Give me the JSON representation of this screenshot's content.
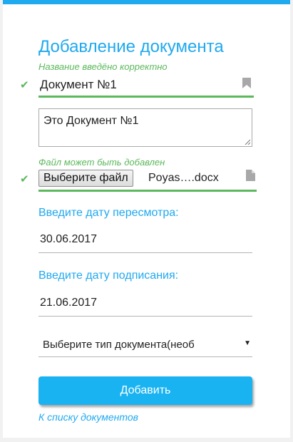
{
  "form": {
    "title": "Добавление документа",
    "name_hint": "Название введёно корректно",
    "name_value": "Документ №1",
    "description_value": "Это Документ №1",
    "file_hint": "Файл может быть добавлен",
    "file_button_label": "Выберите файл",
    "file_name": "Poyas….docx",
    "review_date_label": "Введите дату пересмотра:",
    "review_date_value": "30.06.2017",
    "sign_date_label": "Введите дату подписания:",
    "sign_date_value": "21.06.2017",
    "doc_type_selected": "Выберите тип документа(необ",
    "submit_label": "Добавить",
    "back_link": "К списку документов"
  },
  "colors": {
    "accent": "#1fa9ef",
    "valid": "#5cb85c",
    "button": "#19b3f2"
  },
  "icons": {
    "valid": "check-icon",
    "name_field": "bookmark-icon",
    "file_field": "file-icon",
    "select": "caret-down-icon"
  }
}
